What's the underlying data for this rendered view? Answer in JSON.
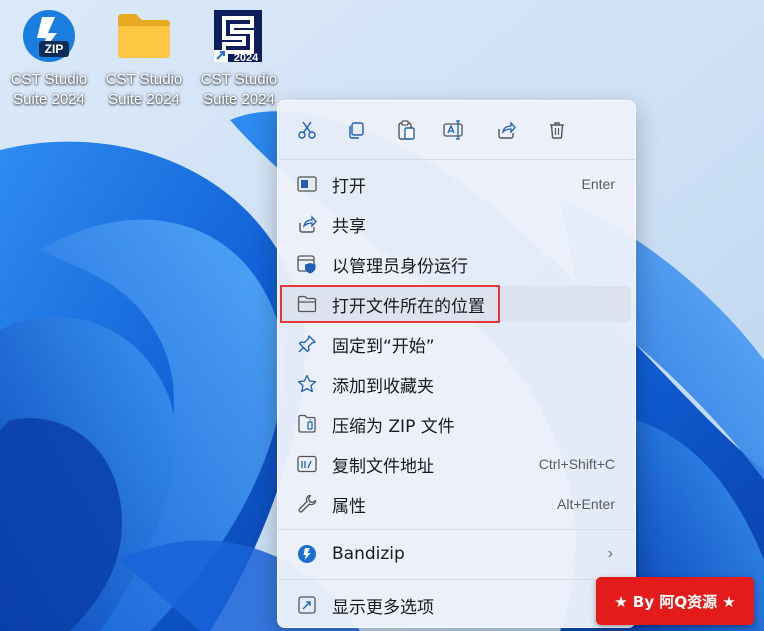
{
  "desktop": {
    "icons": [
      {
        "label_line1": "CST Studio",
        "label_line2": "Suite 2024",
        "icon": "zip-archive-icon"
      },
      {
        "label_line1": "CST Studio",
        "label_line2": "Suite 2024",
        "icon": "folder-icon"
      },
      {
        "label_line1": "CST Studio",
        "label_line2": "Suite 2024",
        "icon": "cst-app-shortcut-icon",
        "badge": "2024"
      }
    ],
    "zip_badge": "ZIP"
  },
  "context_menu": {
    "toolbar": [
      {
        "name": "cut",
        "icon": "scissors-icon"
      },
      {
        "name": "copy",
        "icon": "copy-icon"
      },
      {
        "name": "paste",
        "icon": "paste-icon"
      },
      {
        "name": "rename",
        "icon": "rename-icon"
      },
      {
        "name": "share",
        "icon": "share-icon"
      },
      {
        "name": "delete",
        "icon": "trash-icon"
      }
    ],
    "items": [
      {
        "label": "打开",
        "shortcut": "Enter",
        "icon": "open-window-icon"
      },
      {
        "label": "共享",
        "shortcut": "",
        "icon": "share-icon"
      },
      {
        "label": "以管理员身份运行",
        "shortcut": "",
        "icon": "shield-admin-icon"
      },
      {
        "label": "打开文件所在的位置",
        "shortcut": "",
        "icon": "folder-open-icon"
      },
      {
        "label": "固定到“开始”",
        "shortcut": "",
        "icon": "pin-icon"
      },
      {
        "label": "添加到收藏夹",
        "shortcut": "",
        "icon": "star-icon"
      },
      {
        "label": "压缩为 ZIP 文件",
        "shortcut": "",
        "icon": "zip-file-icon"
      },
      {
        "label": "复制文件地址",
        "shortcut": "Ctrl+Shift+C",
        "icon": "copy-path-icon"
      },
      {
        "label": "属性",
        "shortcut": "Alt+Enter",
        "icon": "wrench-icon"
      }
    ],
    "bandizip": {
      "label": "Bandizip",
      "icon": "bandizip-icon"
    },
    "more_options": {
      "label": "显示更多选项",
      "icon": "more-options-icon"
    }
  },
  "watermark": {
    "text": "★ By 阿Q资源 ★"
  },
  "colors": {
    "accent": "#0067c0",
    "highlight_border": "#e53935",
    "watermark_bg": "#e41b1b"
  }
}
